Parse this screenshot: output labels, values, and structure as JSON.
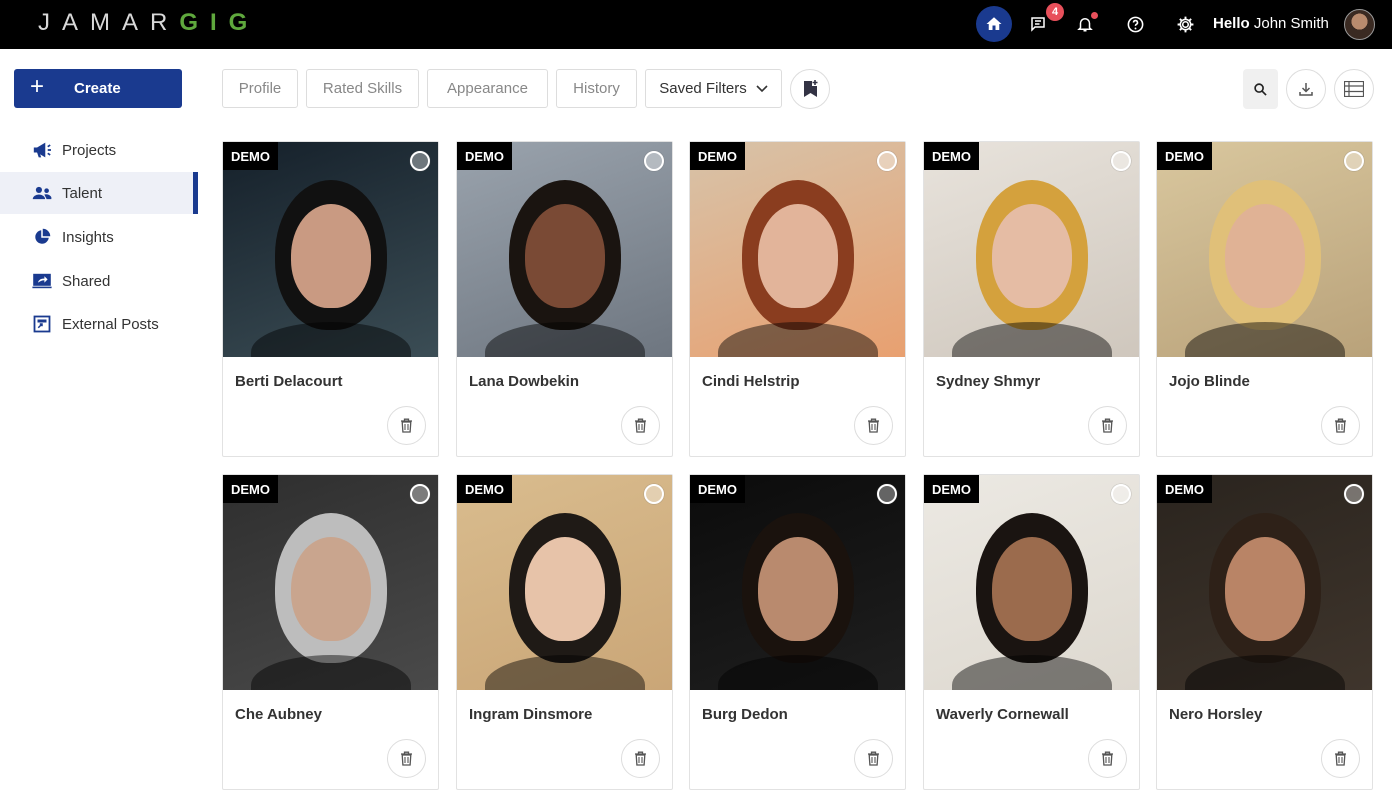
{
  "app": {
    "logo_part1": "JAMAR",
    "logo_part2": "GIG",
    "greeting_hello": "Hello",
    "user_name": "John Smith",
    "chat_badge": "4"
  },
  "sidebar": {
    "create_label": "Create",
    "items": [
      {
        "label": "Projects",
        "icon": "megaphone-icon"
      },
      {
        "label": "Talent",
        "icon": "people-icon"
      },
      {
        "label": "Insights",
        "icon": "pie-chart-icon"
      },
      {
        "label": "Shared",
        "icon": "share-screen-icon"
      },
      {
        "label": "External Posts",
        "icon": "external-post-icon"
      }
    ]
  },
  "filters": {
    "profile": "Profile",
    "rated_skills": "Rated Skills",
    "appearance": "Appearance",
    "history": "History",
    "saved_filters": "Saved Filters"
  },
  "talent": [
    {
      "name": "Berti Delacourt",
      "tag": "DEMO"
    },
    {
      "name": "Lana Dowbekin",
      "tag": "DEMO"
    },
    {
      "name": "Cindi Helstrip",
      "tag": "DEMO"
    },
    {
      "name": "Sydney Shmyr",
      "tag": "DEMO"
    },
    {
      "name": "Jojo Blinde",
      "tag": "DEMO"
    },
    {
      "name": "Che Aubney",
      "tag": "DEMO"
    },
    {
      "name": "Ingram Dinsmore",
      "tag": "DEMO"
    },
    {
      "name": "Burg Dedon",
      "tag": "DEMO"
    },
    {
      "name": "Waverly Cornewall",
      "tag": "DEMO"
    },
    {
      "name": "Nero Horsley",
      "tag": "DEMO"
    }
  ],
  "colors": {
    "brand_blue": "#1a3a8f",
    "brand_green": "#5fa83d",
    "badge_red": "#e8505b"
  }
}
